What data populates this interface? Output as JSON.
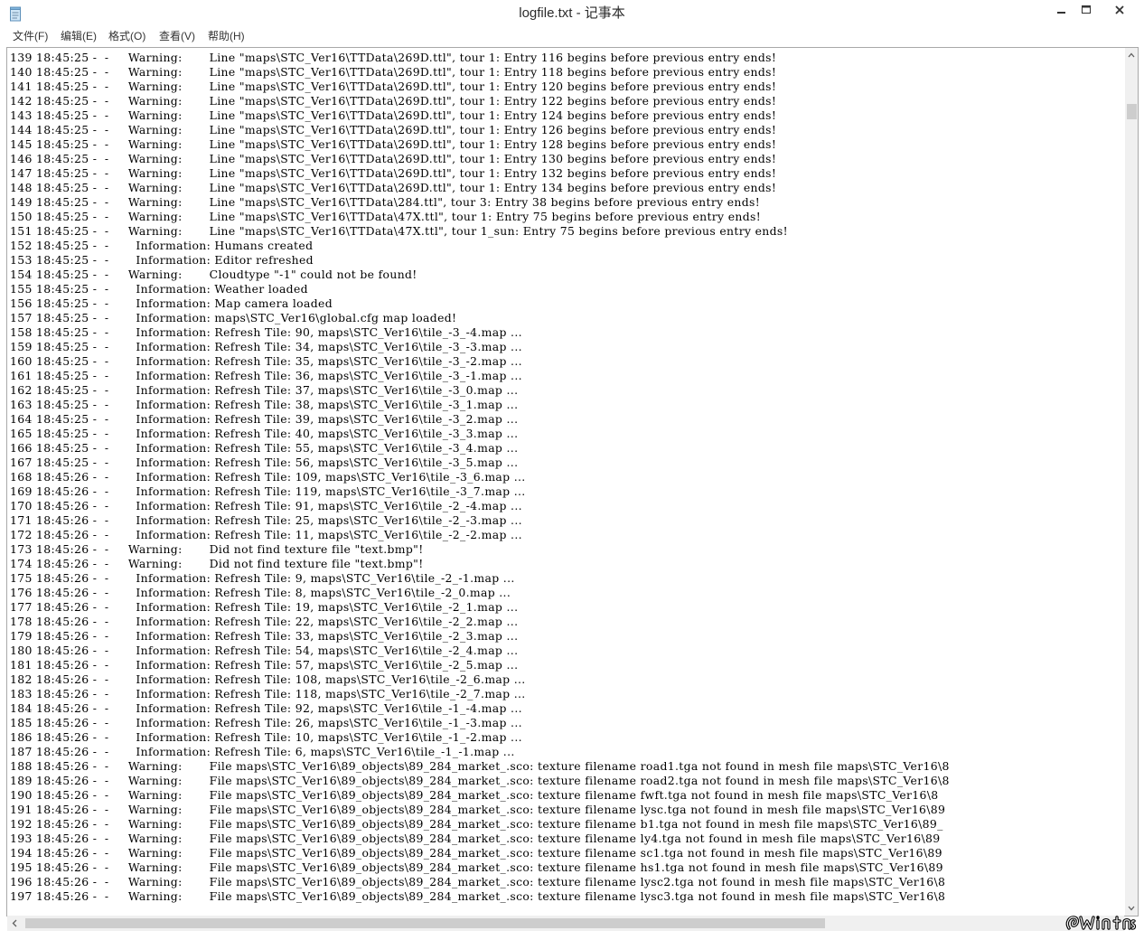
{
  "window": {
    "title": "logfile.txt - 记事本",
    "icon": "notepad-icon",
    "controls": [
      "minimize-icon",
      "maximize-icon",
      "close-icon"
    ]
  },
  "menu": [
    {
      "label": "文件(F)"
    },
    {
      "label": "编辑(E)"
    },
    {
      "label": "格式(O)"
    },
    {
      "label": "查看(V)"
    },
    {
      "label": "帮助(H)"
    }
  ],
  "lines": [
    "139 18:45:25 -  -     Warning:       Line \"maps\\STC_Ver16\\TTData\\269D.ttl\", tour 1: Entry 116 begins before previous entry ends!",
    "140 18:45:25 -  -     Warning:       Line \"maps\\STC_Ver16\\TTData\\269D.ttl\", tour 1: Entry 118 begins before previous entry ends!",
    "141 18:45:25 -  -     Warning:       Line \"maps\\STC_Ver16\\TTData\\269D.ttl\", tour 1: Entry 120 begins before previous entry ends!",
    "142 18:45:25 -  -     Warning:       Line \"maps\\STC_Ver16\\TTData\\269D.ttl\", tour 1: Entry 122 begins before previous entry ends!",
    "143 18:45:25 -  -     Warning:       Line \"maps\\STC_Ver16\\TTData\\269D.ttl\", tour 1: Entry 124 begins before previous entry ends!",
    "144 18:45:25 -  -     Warning:       Line \"maps\\STC_Ver16\\TTData\\269D.ttl\", tour 1: Entry 126 begins before previous entry ends!",
    "145 18:45:25 -  -     Warning:       Line \"maps\\STC_Ver16\\TTData\\269D.ttl\", tour 1: Entry 128 begins before previous entry ends!",
    "146 18:45:25 -  -     Warning:       Line \"maps\\STC_Ver16\\TTData\\269D.ttl\", tour 1: Entry 130 begins before previous entry ends!",
    "147 18:45:25 -  -     Warning:       Line \"maps\\STC_Ver16\\TTData\\269D.ttl\", tour 1: Entry 132 begins before previous entry ends!",
    "148 18:45:25 -  -     Warning:       Line \"maps\\STC_Ver16\\TTData\\269D.ttl\", tour 1: Entry 134 begins before previous entry ends!",
    "149 18:45:25 -  -     Warning:       Line \"maps\\STC_Ver16\\TTData\\284.ttl\", tour 3: Entry 38 begins before previous entry ends!",
    "150 18:45:25 -  -     Warning:       Line \"maps\\STC_Ver16\\TTData\\47X.ttl\", tour 1: Entry 75 begins before previous entry ends!",
    "151 18:45:25 -  -     Warning:       Line \"maps\\STC_Ver16\\TTData\\47X.ttl\", tour 1_sun: Entry 75 begins before previous entry ends!",
    "152 18:45:25 -  -       Information: Humans created",
    "153 18:45:25 -  -       Information: Editor refreshed",
    "154 18:45:25 -  -     Warning:       Cloudtype \"-1\" could not be found!",
    "155 18:45:25 -  -       Information: Weather loaded",
    "156 18:45:25 -  -       Information: Map camera loaded",
    "157 18:45:25 -  -       Information: maps\\STC_Ver16\\global.cfg map loaded!",
    "158 18:45:25 -  -       Information: Refresh Tile: 90, maps\\STC_Ver16\\tile_-3_-4.map ...",
    "159 18:45:25 -  -       Information: Refresh Tile: 34, maps\\STC_Ver16\\tile_-3_-3.map ...",
    "160 18:45:25 -  -       Information: Refresh Tile: 35, maps\\STC_Ver16\\tile_-3_-2.map ...",
    "161 18:45:25 -  -       Information: Refresh Tile: 36, maps\\STC_Ver16\\tile_-3_-1.map ...",
    "162 18:45:25 -  -       Information: Refresh Tile: 37, maps\\STC_Ver16\\tile_-3_0.map ...",
    "163 18:45:25 -  -       Information: Refresh Tile: 38, maps\\STC_Ver16\\tile_-3_1.map ...",
    "164 18:45:25 -  -       Information: Refresh Tile: 39, maps\\STC_Ver16\\tile_-3_2.map ...",
    "165 18:45:25 -  -       Information: Refresh Tile: 40, maps\\STC_Ver16\\tile_-3_3.map ...",
    "166 18:45:25 -  -       Information: Refresh Tile: 55, maps\\STC_Ver16\\tile_-3_4.map ...",
    "167 18:45:25 -  -       Information: Refresh Tile: 56, maps\\STC_Ver16\\tile_-3_5.map ...",
    "168 18:45:26 -  -       Information: Refresh Tile: 109, maps\\STC_Ver16\\tile_-3_6.map ...",
    "169 18:45:26 -  -       Information: Refresh Tile: 119, maps\\STC_Ver16\\tile_-3_7.map ...",
    "170 18:45:26 -  -       Information: Refresh Tile: 91, maps\\STC_Ver16\\tile_-2_-4.map ...",
    "171 18:45:26 -  -       Information: Refresh Tile: 25, maps\\STC_Ver16\\tile_-2_-3.map ...",
    "172 18:45:26 -  -       Information: Refresh Tile: 11, maps\\STC_Ver16\\tile_-2_-2.map ...",
    "173 18:45:26 -  -     Warning:       Did not find texture file \"text.bmp\"!",
    "174 18:45:26 -  -     Warning:       Did not find texture file \"text.bmp\"!",
    "175 18:45:26 -  -       Information: Refresh Tile: 9, maps\\STC_Ver16\\tile_-2_-1.map ...",
    "176 18:45:26 -  -       Information: Refresh Tile: 8, maps\\STC_Ver16\\tile_-2_0.map ...",
    "177 18:45:26 -  -       Information: Refresh Tile: 19, maps\\STC_Ver16\\tile_-2_1.map ...",
    "178 18:45:26 -  -       Information: Refresh Tile: 22, maps\\STC_Ver16\\tile_-2_2.map ...",
    "179 18:45:26 -  -       Information: Refresh Tile: 33, maps\\STC_Ver16\\tile_-2_3.map ...",
    "180 18:45:26 -  -       Information: Refresh Tile: 54, maps\\STC_Ver16\\tile_-2_4.map ...",
    "181 18:45:26 -  -       Information: Refresh Tile: 57, maps\\STC_Ver16\\tile_-2_5.map ...",
    "182 18:45:26 -  -       Information: Refresh Tile: 108, maps\\STC_Ver16\\tile_-2_6.map ...",
    "183 18:45:26 -  -       Information: Refresh Tile: 118, maps\\STC_Ver16\\tile_-2_7.map ...",
    "184 18:45:26 -  -       Information: Refresh Tile: 92, maps\\STC_Ver16\\tile_-1_-4.map ...",
    "185 18:45:26 -  -       Information: Refresh Tile: 26, maps\\STC_Ver16\\tile_-1_-3.map ...",
    "186 18:45:26 -  -       Information: Refresh Tile: 10, maps\\STC_Ver16\\tile_-1_-2.map ...",
    "187 18:45:26 -  -       Information: Refresh Tile: 6, maps\\STC_Ver16\\tile_-1_-1.map ...",
    "188 18:45:26 -  -     Warning:       File maps\\STC_Ver16\\89_objects\\89_284_market_.sco: texture filename road1.tga not found in mesh file maps\\STC_Ver16\\8",
    "189 18:45:26 -  -     Warning:       File maps\\STC_Ver16\\89_objects\\89_284_market_.sco: texture filename road2.tga not found in mesh file maps\\STC_Ver16\\8",
    "190 18:45:26 -  -     Warning:       File maps\\STC_Ver16\\89_objects\\89_284_market_.sco: texture filename fwft.tga not found in mesh file maps\\STC_Ver16\\8",
    "191 18:45:26 -  -     Warning:       File maps\\STC_Ver16\\89_objects\\89_284_market_.sco: texture filename lysc.tga not found in mesh file maps\\STC_Ver16\\89",
    "192 18:45:26 -  -     Warning:       File maps\\STC_Ver16\\89_objects\\89_284_market_.sco: texture filename b1.tga not found in mesh file maps\\STC_Ver16\\89_",
    "193 18:45:26 -  -     Warning:       File maps\\STC_Ver16\\89_objects\\89_284_market_.sco: texture filename ly4.tga not found in mesh file maps\\STC_Ver16\\89",
    "194 18:45:26 -  -     Warning:       File maps\\STC_Ver16\\89_objects\\89_284_market_.sco: texture filename sc1.tga not found in mesh file maps\\STC_Ver16\\89",
    "195 18:45:26 -  -     Warning:       File maps\\STC_Ver16\\89_objects\\89_284_market_.sco: texture filename hs1.tga not found in mesh file maps\\STC_Ver16\\89",
    "196 18:45:26 -  -     Warning:       File maps\\STC_Ver16\\89_objects\\89_284_market_.sco: texture filename lysc2.tga not found in mesh file maps\\STC_Ver16\\8",
    "197 18:45:26 -  -     Warning:       File maps\\STC_Ver16\\89_objects\\89_284_market_.sco: texture filename lysc3.tga not found in mesh file maps\\STC_Ver16\\8"
  ],
  "scrollbars": {
    "vertical_position": 0.05,
    "horizontal_visible_fraction": 0.74
  },
  "watermark": {
    "icon": "watermark-logo-icon"
  }
}
